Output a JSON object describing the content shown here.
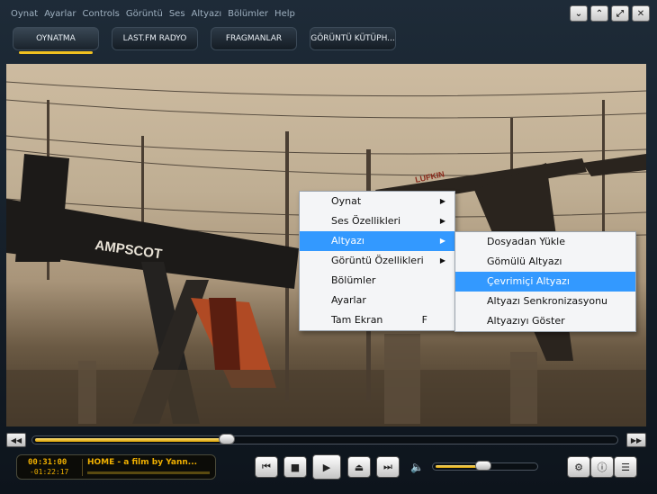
{
  "menubar": {
    "items": [
      "Oynat",
      "Ayarlar",
      "Controls",
      "Görüntü",
      "Ses",
      "Altyazı",
      "Bölümler",
      "Help"
    ]
  },
  "window_controls": {
    "collapse": "⌄",
    "expand": "⌃",
    "restore": "⤢",
    "close": "✕"
  },
  "tabs": [
    {
      "label": "OYNATMA",
      "active": true
    },
    {
      "label": "LAST.FM RADYO",
      "active": false
    },
    {
      "label": "FRAGMANLAR",
      "active": false
    },
    {
      "label": "GÖRÜNTÜ KÜTÜPH...",
      "active": false
    }
  ],
  "video": {
    "sign_text": "AMPSCOT",
    "sign_text_2": "LUFKIN"
  },
  "context_menu": {
    "items": [
      {
        "label": "Oynat",
        "submenu": true,
        "highlighted": false,
        "shortcut": ""
      },
      {
        "label": "Ses Özellikleri",
        "submenu": true,
        "highlighted": false,
        "shortcut": ""
      },
      {
        "label": "Altyazı",
        "submenu": true,
        "highlighted": true,
        "shortcut": ""
      },
      {
        "label": "Görüntü Özellikleri",
        "submenu": true,
        "highlighted": false,
        "shortcut": ""
      },
      {
        "label": "Bölümler",
        "submenu": false,
        "highlighted": false,
        "shortcut": ""
      },
      {
        "label": "Ayarlar",
        "submenu": false,
        "highlighted": false,
        "shortcut": ""
      },
      {
        "label": "Tam Ekran",
        "submenu": false,
        "highlighted": false,
        "shortcut": "F"
      }
    ],
    "submenu_arrow": "▶"
  },
  "subtitle_menu": {
    "items": [
      {
        "label": "Dosyadan Yükle",
        "highlighted": false
      },
      {
        "label": "Gömülü Altyazı",
        "highlighted": false
      },
      {
        "label": "Çevrimiçi Altyazı",
        "highlighted": true
      },
      {
        "label": "Altyazı Senkronizasyonu",
        "highlighted": false
      },
      {
        "label": "Altyazıyı Göster",
        "highlighted": false
      }
    ]
  },
  "seek": {
    "back_label": "◀◀",
    "forward_label": "▶▶",
    "progress": 0.33
  },
  "lcd": {
    "elapsed": "00:31:00",
    "remaining": "-01:22:17",
    "now_playing": "HOME - a film by Yann..."
  },
  "controls": {
    "prev": "⏮",
    "stop": "■",
    "play": "▶",
    "eject": "⏏",
    "next": "⏭",
    "volume_icon": "🔈",
    "settings": "⚙",
    "info": "ⓘ",
    "playlist": "☰"
  },
  "volume": {
    "level": 0.48
  },
  "colors": {
    "accent": "#f0c020",
    "highlight": "#3399ff",
    "lcd_text": "#f0b000"
  }
}
